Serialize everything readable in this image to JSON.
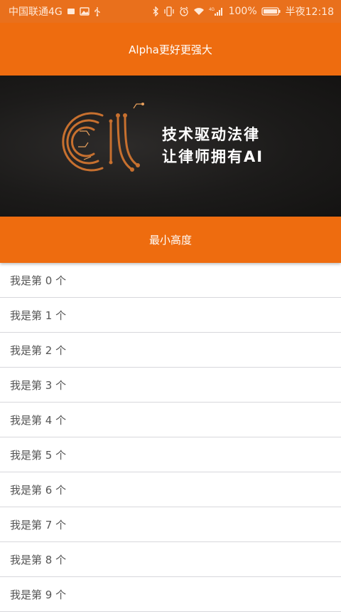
{
  "status_bar": {
    "carrier": "中国联通4G",
    "battery": "100%",
    "time": "半夜12:18",
    "network_badge": "4G",
    "icons": [
      "square-icon",
      "image-icon",
      "usb-icon",
      "bluetooth-icon",
      "vibrate-icon",
      "alarm-icon",
      "wifi-icon",
      "signal-icon",
      "battery-icon"
    ]
  },
  "title_bar": {
    "title": "Alpha更好更强大"
  },
  "banner": {
    "line1": "技术驱动法律",
    "line2": "让律师拥有AI"
  },
  "min_bar": {
    "label": "最小高度"
  },
  "list": {
    "items": [
      "我是第 0 个",
      "我是第 1 个",
      "我是第 2 个",
      "我是第 3 个",
      "我是第 4 个",
      "我是第 5 个",
      "我是第 6 个",
      "我是第 7 个",
      "我是第 8 个",
      "我是第 9 个"
    ]
  },
  "colors": {
    "accent": "#ee6c0f",
    "status_bar": "#e9701c",
    "banner_bg": "#1c1b1a",
    "logo": "#c7702f"
  }
}
